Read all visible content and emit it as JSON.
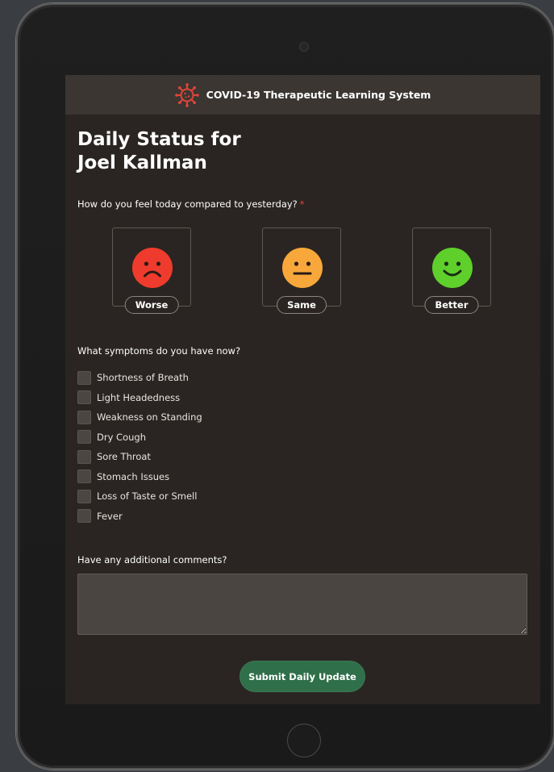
{
  "header": {
    "app_title": "COVID-19 Therapeutic Learning System",
    "logo_icon": "virus-icon",
    "logo_color": "#e0453a"
  },
  "page": {
    "title_line1": "Daily Status for",
    "title_line2": "Joel Kallman"
  },
  "mood_question": {
    "label": "How do you feel today compared to yesterday?",
    "required_marker": "*",
    "options": [
      {
        "label": "Worse",
        "icon": "frowning-face-icon",
        "color": "#ef3b2d"
      },
      {
        "label": "Same",
        "icon": "neutral-face-icon",
        "color": "#f8a83a"
      },
      {
        "label": "Better",
        "icon": "smiling-face-icon",
        "color": "#5ecf2b"
      }
    ]
  },
  "symptoms": {
    "label": "What symptoms do you have now?",
    "items": [
      {
        "label": "Shortness of Breath",
        "checked": false
      },
      {
        "label": "Light Headedness",
        "checked": false
      },
      {
        "label": "Weakness on Standing",
        "checked": false
      },
      {
        "label": "Dry Cough",
        "checked": false
      },
      {
        "label": "Sore Throat",
        "checked": false
      },
      {
        "label": "Stomach Issues",
        "checked": false
      },
      {
        "label": "Loss of Taste or Smell",
        "checked": false
      },
      {
        "label": "Fever",
        "checked": false
      }
    ]
  },
  "comments": {
    "label": "Have any additional comments?",
    "value": ""
  },
  "submit": {
    "label": "Submit Daily Update",
    "color": "#2f6f49"
  }
}
